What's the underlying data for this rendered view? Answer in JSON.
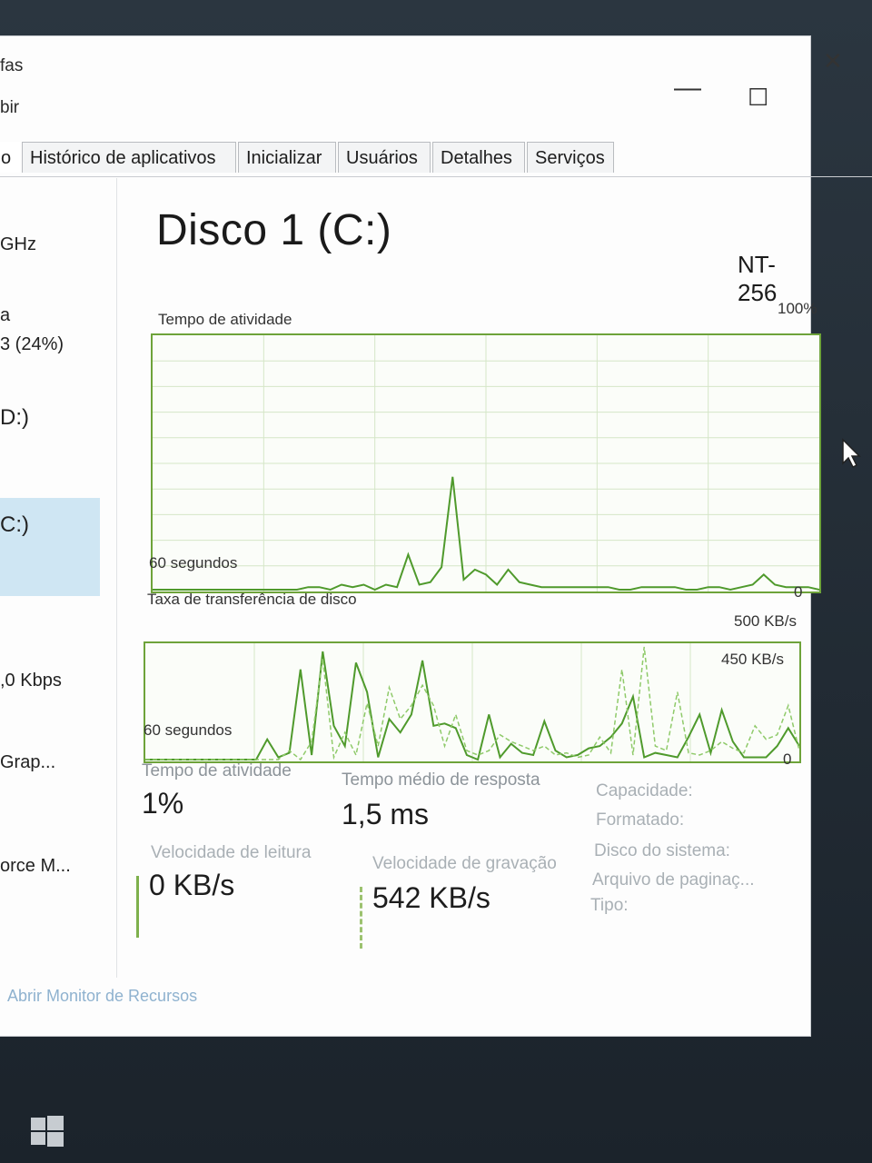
{
  "titlebar": {
    "menu_line_1": "fas",
    "menu_line_2": "bir",
    "minimize_symbol": "—",
    "maximize_symbol": "☐",
    "close_symbol": "✕"
  },
  "tabs": [
    {
      "label": "o"
    },
    {
      "label": "Histórico de aplicativos"
    },
    {
      "label": "Inicializar"
    },
    {
      "label": "Usuários"
    },
    {
      "label": "Detalhes"
    },
    {
      "label": "Serviços"
    }
  ],
  "sidebar": {
    "items": [
      {
        "label": "GHz"
      },
      {
        "label": "a"
      },
      {
        "label": "3 (24%)"
      },
      {
        "label": "D:)"
      },
      {
        "label": "C:)"
      },
      {
        "label": ",0 Kbps"
      },
      {
        "label": "Grap..."
      },
      {
        "label": "orce M..."
      }
    ]
  },
  "main": {
    "title": "Disco 1 (C:)",
    "model": "NT-256",
    "activity_chart": {
      "label": "Tempo de atividade",
      "max_label": "100%",
      "time_label": "60 segundos",
      "min_label": "0"
    },
    "transfer_chart": {
      "label": "Taxa de transferência de disco",
      "max_label": "500 KB/s",
      "mid_label": "450 KB/s",
      "time_label": "60 segundos",
      "min_label": "0"
    },
    "stats": {
      "active_time_label": "Tempo de atividade",
      "active_time_value": "1%",
      "avg_response_label": "Tempo médio de resposta",
      "avg_response_value": "1,5 ms",
      "read_speed_label": "Velocidade de leitura",
      "read_speed_value": "0 KB/s",
      "write_speed_label": "Velocidade de gravação",
      "write_speed_value": "542 KB/s"
    },
    "properties": [
      {
        "label": "Capacidade:"
      },
      {
        "label": "Formatado:"
      },
      {
        "label": "Disco do sistema:"
      },
      {
        "label": "Arquivo de paginaç..."
      },
      {
        "label": "Tipo:"
      }
    ],
    "open_monitor_link": "Abrir Monitor de Recursos"
  },
  "chart_data": [
    {
      "type": "line",
      "title": "Tempo de atividade",
      "x_range_label": "60 segundos",
      "ylim": [
        0,
        100
      ],
      "grid": true,
      "series": [
        {
          "values": [
            0,
            0,
            0,
            0,
            0,
            0,
            0,
            0,
            0,
            0,
            0,
            0,
            0,
            0,
            1,
            1,
            0,
            2,
            1,
            2,
            0,
            2,
            1,
            14,
            2,
            3,
            9,
            45,
            4,
            8,
            6,
            2,
            8,
            3,
            2,
            1,
            1,
            1,
            1,
            1,
            1,
            1,
            0,
            0,
            1,
            1,
            1,
            1,
            0,
            0,
            1,
            1,
            0,
            1,
            2,
            6,
            2,
            1,
            1,
            1,
            0
          ]
        }
      ],
      "color": "#4f9a2c"
    },
    {
      "type": "line",
      "title": "Taxa de transferência de disco",
      "x_range_label": "60 segundos",
      "ylim": [
        0,
        500
      ],
      "grid": true,
      "series": [
        {
          "values": [
            0,
            0,
            0,
            0,
            0,
            0,
            0,
            0,
            0,
            0,
            0,
            90,
            10,
            30,
            400,
            20,
            480,
            150,
            60,
            430,
            300,
            10,
            180,
            120,
            200,
            440,
            150,
            160,
            140,
            20,
            0,
            200,
            10,
            70,
            30,
            20,
            170,
            40,
            10,
            20,
            50,
            60,
            100,
            160,
            280,
            10,
            30,
            20,
            10,
            100,
            200,
            30,
            220,
            80,
            10,
            10,
            10,
            60,
            140,
            60
          ]
        },
        {
          "values": [
            0,
            0,
            0,
            0,
            0,
            0,
            0,
            0,
            0,
            0,
            0,
            0,
            0,
            40,
            0,
            80,
            450,
            10,
            120,
            20,
            250,
            60,
            320,
            180,
            240,
            330,
            240,
            60,
            200,
            40,
            20,
            40,
            110,
            80,
            60,
            40,
            60,
            20,
            30,
            10,
            20,
            100,
            30,
            400,
            20,
            500,
            60,
            40,
            300,
            30,
            20,
            40,
            80,
            50,
            30,
            150,
            90,
            110,
            240,
            40
          ]
        }
      ],
      "colors": [
        "#4f9a2c",
        "#8fca6a"
      ]
    }
  ]
}
